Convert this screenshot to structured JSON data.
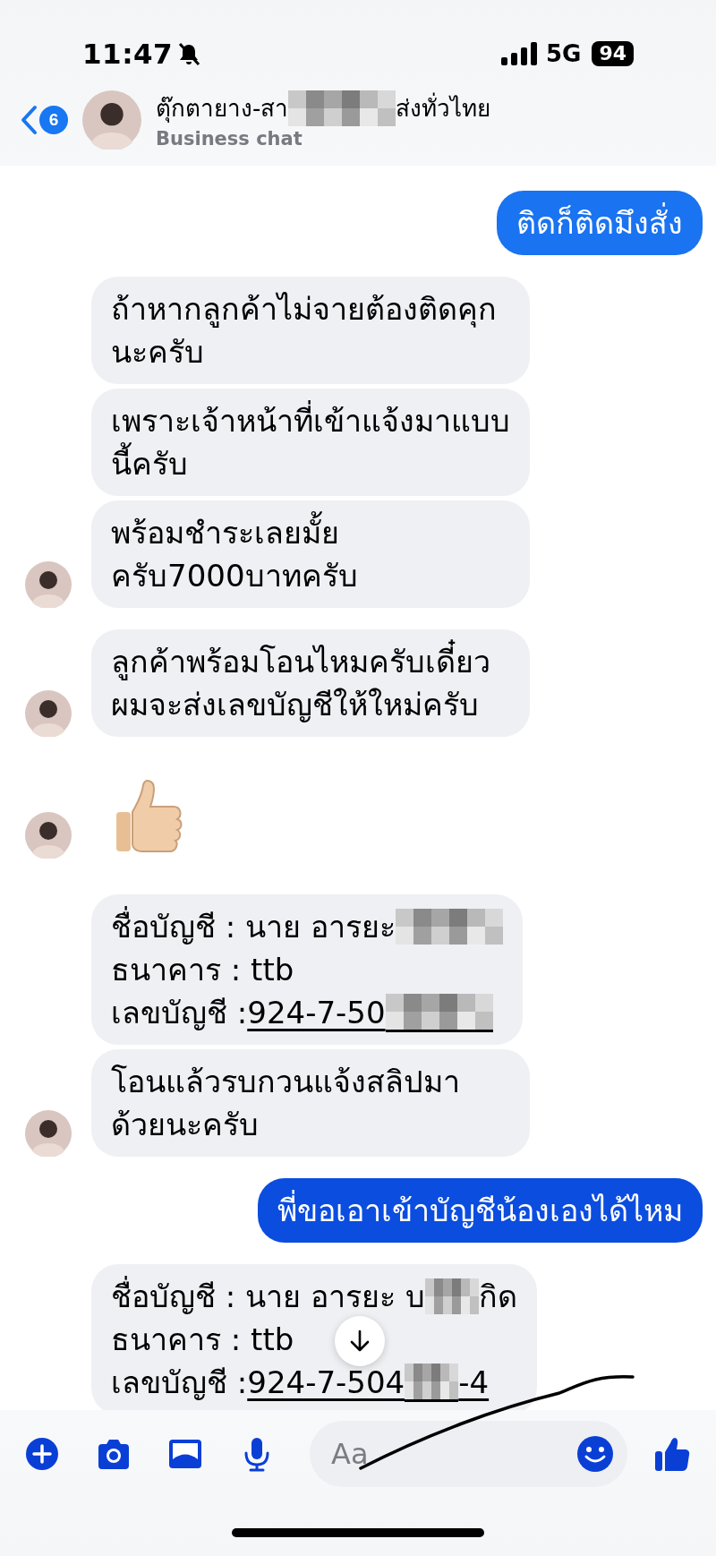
{
  "status_bar": {
    "time": "11:47",
    "network": "5G",
    "battery": "94"
  },
  "header": {
    "unread_count": "6",
    "title_parts": [
      {
        "kind": "text",
        "text": "ตุ๊กตายาง-สา"
      },
      {
        "kind": "redaction",
        "wide": true
      },
      {
        "kind": "text",
        "text": "ส่งทั่วไทย"
      }
    ],
    "subtitle": "Business chat"
  },
  "messages": [
    {
      "kind": "text",
      "outgoing": true,
      "color": "#1a73f0",
      "text": "ติดก็ติดมึงสั่ง"
    },
    {
      "kind": "text",
      "outgoing": false,
      "show_avatar": false,
      "text": "ถ้าหากลูกค้าไม่จายต้องติดคุกนะครับ"
    },
    {
      "kind": "text",
      "outgoing": false,
      "show_avatar": false,
      "text": "เพราะเจ้าหน้าที่เข้าแจ้งมาแบบนี้ครับ"
    },
    {
      "kind": "text",
      "outgoing": false,
      "show_avatar": true,
      "text": "พร้อมชำระเลยมั้ยครับ7000บาทครับ"
    },
    {
      "kind": "text",
      "outgoing": false,
      "show_avatar": true,
      "text": "ลูกค้าพร้อมโอนไหมครับเดี๋ยวผมจะส่งเลขบัญชีให้ใหม่ครับ"
    },
    {
      "kind": "emoji",
      "outgoing": false,
      "show_avatar": true
    },
    {
      "kind": "account",
      "outgoing": false,
      "show_avatar": false,
      "lines": [
        {
          "parts": [
            {
              "kind": "text",
              "text": "ชื่อบัญชี : นาย อารยะ",
              "underlined": false
            },
            {
              "kind": "redaction",
              "wide": true,
              "underlined": false
            }
          ]
        },
        {
          "parts": [
            {
              "kind": "text",
              "text": "ธนาคาร : ttb",
              "underlined": false
            }
          ]
        },
        {
          "parts": [
            {
              "kind": "text",
              "text": "เลขบัญชี : ",
              "underlined": false
            },
            {
              "kind": "text",
              "text": "924-7-50",
              "underlined": true
            },
            {
              "kind": "redaction",
              "wide": true,
              "underlined": true
            }
          ]
        }
      ]
    },
    {
      "kind": "text",
      "outgoing": false,
      "show_avatar": true,
      "text": "โอนแล้วรบกวนแจ้งสลิปมาด้วยนะครับ"
    },
    {
      "kind": "text",
      "outgoing": true,
      "color": "#0b4ddf",
      "text": "พี่ขอเอาเข้าบัญชีน้องเองได้ไหม"
    },
    {
      "kind": "account",
      "outgoing": false,
      "show_avatar": false,
      "lines": [
        {
          "parts": [
            {
              "kind": "text",
              "text": "ชื่อบัญชี : นาย อารยะ บ",
              "underlined": false
            },
            {
              "kind": "redaction",
              "wide": false,
              "underlined": false
            },
            {
              "kind": "text",
              "text": "กิด",
              "underlined": false
            }
          ]
        },
        {
          "parts": [
            {
              "kind": "text",
              "text": "ธนาคาร : ttb",
              "underlined": false
            }
          ]
        },
        {
          "parts": [
            {
              "kind": "text",
              "text": "เลขบัญชี : ",
              "underlined": false
            },
            {
              "kind": "text",
              "text": "924-7-504",
              "underlined": true
            },
            {
              "kind": "redaction",
              "wide": false,
              "underlined": true
            },
            {
              "kind": "text",
              "text": "-4",
              "underlined": true
            }
          ]
        }
      ]
    }
  ],
  "composer": {
    "placeholder": "Aa"
  }
}
